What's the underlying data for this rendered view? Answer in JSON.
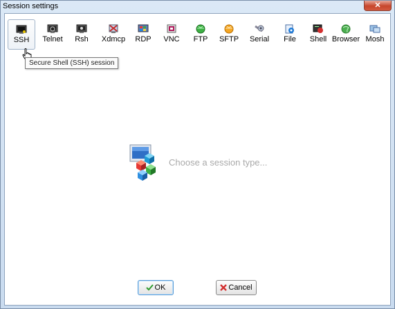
{
  "window": {
    "title": "Session settings",
    "close_glyph": "✕"
  },
  "toolbar": {
    "items": [
      {
        "label": "SSH",
        "icon": "ssh-icon",
        "active": true
      },
      {
        "label": "Telnet",
        "icon": "telnet-icon"
      },
      {
        "label": "Rsh",
        "icon": "rsh-icon"
      },
      {
        "label": "Xdmcp",
        "icon": "xdmcp-icon"
      },
      {
        "label": "RDP",
        "icon": "rdp-icon"
      },
      {
        "label": "VNC",
        "icon": "vnc-icon"
      },
      {
        "label": "FTP",
        "icon": "ftp-icon"
      },
      {
        "label": "SFTP",
        "icon": "sftp-icon"
      },
      {
        "label": "Serial",
        "icon": "serial-icon"
      },
      {
        "label": "File",
        "icon": "file-icon"
      },
      {
        "label": "Shell",
        "icon": "shell-icon"
      },
      {
        "label": "Browser",
        "icon": "browser-icon"
      },
      {
        "label": "Mosh",
        "icon": "mosh-icon"
      }
    ]
  },
  "tooltip": {
    "text": "Secure Shell (SSH) session"
  },
  "placeholder": {
    "text": "Choose a session type..."
  },
  "buttons": {
    "ok_label": "OK",
    "cancel_label": "Cancel"
  },
  "colors": {
    "accent": "#5a9bd5",
    "close": "#c7462c",
    "placeholder_text": "#a9a9a9"
  }
}
